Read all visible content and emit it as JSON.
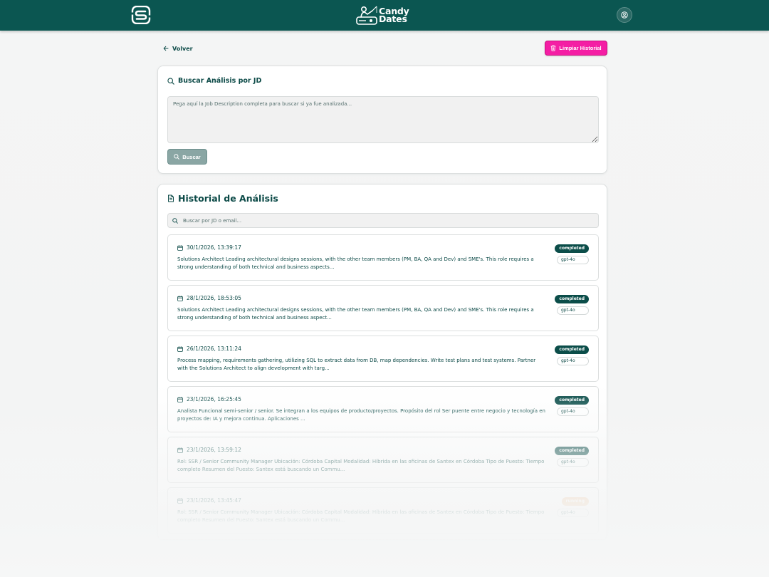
{
  "header": {
    "brand_line1": "Candy",
    "brand_line2": "Dates"
  },
  "nav": {
    "back_label": "Volver",
    "clear_history_label": "Limpiar Historial"
  },
  "search": {
    "title": "Buscar Análisis por JD",
    "placeholder": "Pega aquí la Job Description completa para buscar si ya fue analizada...",
    "button_label": "Buscar"
  },
  "history": {
    "title": "Historial de Análisis",
    "filter_placeholder": "Buscar por JD o email...",
    "items": [
      {
        "date": "30/1/2026, 13:39:17",
        "description": "Solutions Architect Leading architectural designs sessions, with the other team members (PM, BA, QA and Dev) and SME's. This role requires a strong understanding of both technical and business aspects...",
        "status": "completed",
        "model": "gpt-4o"
      },
      {
        "date": "28/1/2026, 18:53:05",
        "description": "Solutions Architect Leading architectural designs sessions, with the other team members (PM, BA, QA and Dev) and SME's. This role requires a strong understanding of both technical and business aspect...",
        "status": "completed",
        "model": "gpt-4o"
      },
      {
        "date": "26/1/2026, 13:11:24",
        "description": "Process mapping, requirements gathering, utilizing SQL to extract data from DB, map dependencies. Write test plans and test systems. Partner with the Solutions Architect to align development with targ...",
        "status": "completed",
        "model": "gpt-4o"
      },
      {
        "date": "23/1/2026, 16:25:45",
        "description": "Analista Funcional semi-senior / senior. Se integran a los equipos de producto/proyectos. Propósito del rol Ser puente entre negocio y tecnología en proyectos de: IA y mejora continua. Aplicaciones ...",
        "status": "completed",
        "model": "gpt-4o"
      },
      {
        "date": "23/1/2026, 13:59:12",
        "description": "Rol: SSR / Senior Community Manager Ubicación: Córdoba Capital Modalidad: Híbrida en las oficinas de Santex en Córdoba Tipo de Puesto: Tiempo completo Resumen del Puesto: Santex está buscando un Commu...",
        "status": "completed",
        "model": "gpt-4o"
      },
      {
        "date": "23/1/2026, 13:45:47",
        "description": "Rol: SSR / Senior Community Manager Ubicación: Córdoba Capital Modalidad: Híbrida en las oficinas de Santex en Córdoba Tipo de Puesto: Tiempo completo Resumen del Puesto: Santex está buscando un Commu...",
        "status": "running",
        "model": "gpt-4o"
      }
    ]
  },
  "icons": {
    "logo": "s-logo-icon",
    "brand": "fisherman-icon",
    "user": "user-icon",
    "back": "arrow-left-icon",
    "trash": "trash-icon",
    "search": "search-icon",
    "document": "document-icon",
    "calendar": "calendar-icon"
  },
  "colors": {
    "primary": "#0b5651",
    "accent_pink": "#f41ea4",
    "status_completed": "#0b4d49",
    "status_running": "#f5c9a0"
  }
}
